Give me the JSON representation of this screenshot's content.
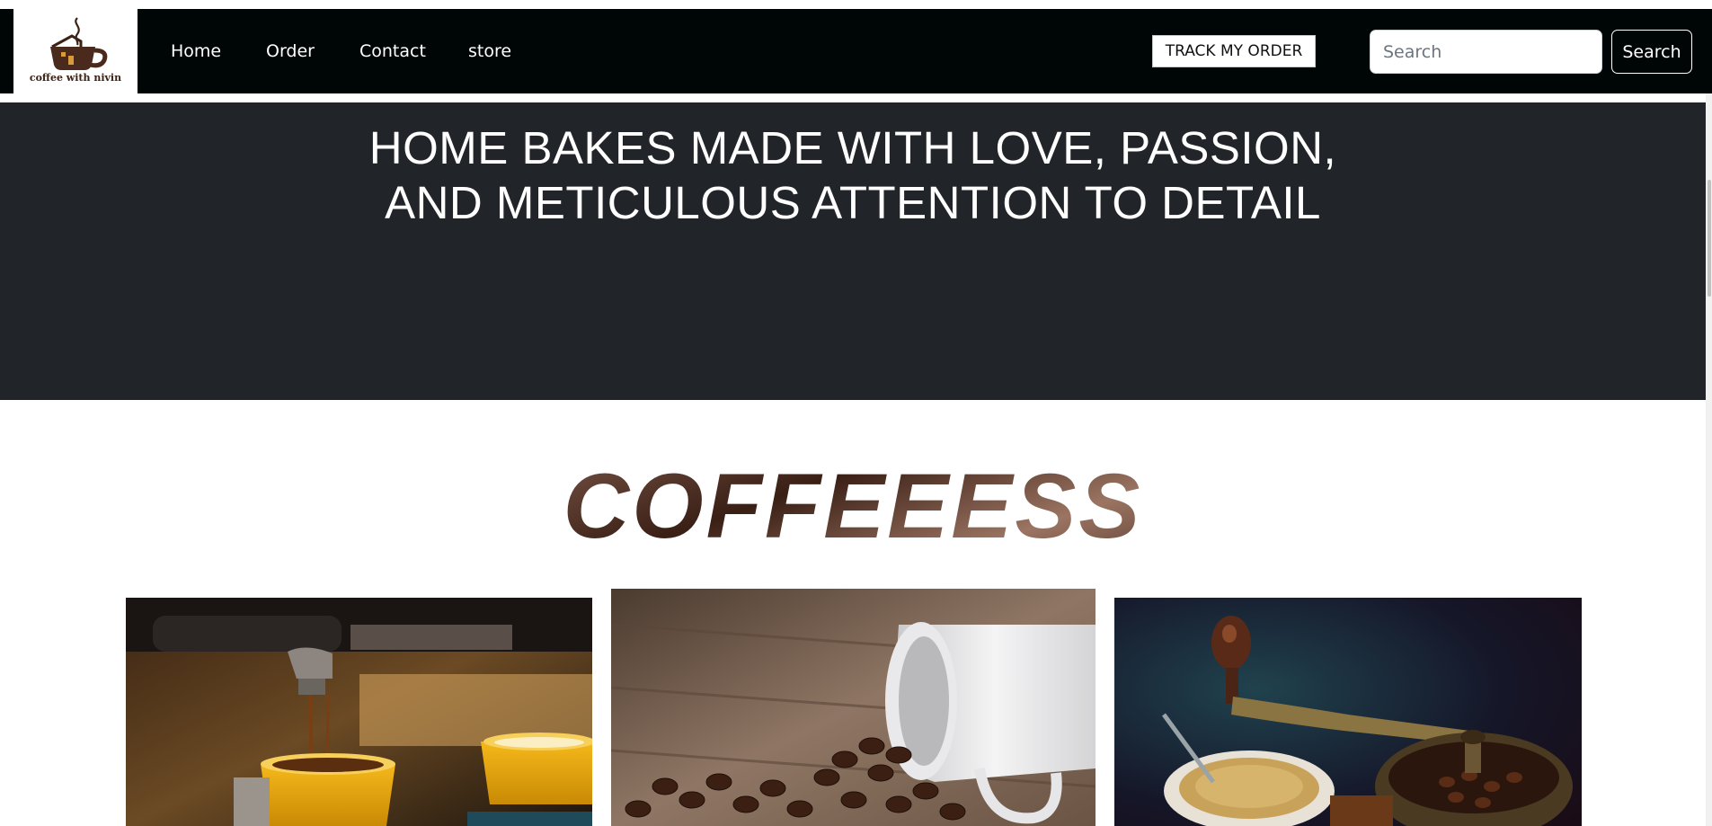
{
  "logo": {
    "text": "coffee with nivin",
    "icon": "coffee-cup-house-icon"
  },
  "nav": {
    "items": [
      {
        "label": "Home"
      },
      {
        "label": "Order"
      },
      {
        "label": "Contact"
      },
      {
        "label": "store"
      }
    ],
    "track_label": "TRACK MY ORDER",
    "search_placeholder": "Search",
    "search_button": "Search"
  },
  "hero": {
    "title_line1": "HOME BAKES MADE WITH LOVE, PASSION,",
    "title_line2": "AND METICULOUS ATTENTION TO DETAIL"
  },
  "section": {
    "heading": "COFFEEESS"
  },
  "gallery": [
    {
      "image": "espresso-machine-pouring-yellow-cup"
    },
    {
      "image": "white-mug-spilled-coffee-beans-on-wood"
    },
    {
      "image": "vintage-coffee-grinder-with-cup"
    }
  ],
  "colors": {
    "navbar_bg": "#000605",
    "hero_bg": "#212429",
    "accent_yellow": "#e8a90f",
    "coffee_brown": "#3b2116"
  }
}
